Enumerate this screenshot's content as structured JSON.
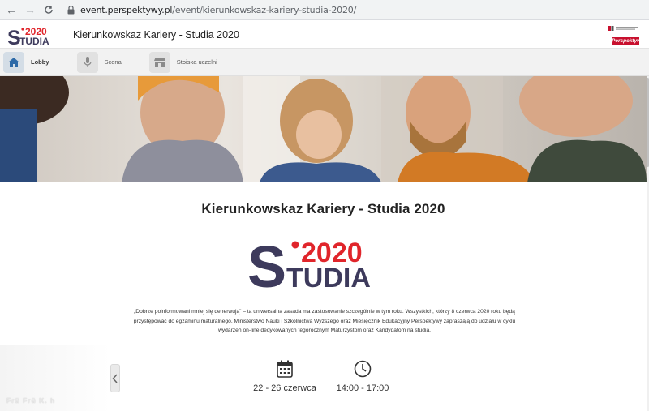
{
  "browser": {
    "url_host": "event.perspektywy.pl",
    "url_path": "/event/kierunkowskaz-kariery-studia-2020/"
  },
  "header": {
    "logo_year": "2020",
    "logo_text": "TUDIA",
    "logo_letter": "S",
    "title": "Kierunkowskaz Kariery - Studia 2020",
    "partner_logo_text": "Perspektywy"
  },
  "tabs": [
    {
      "label": "Lobby",
      "icon": "home-icon",
      "active": true
    },
    {
      "label": "Scena",
      "icon": "microphone-icon",
      "active": false
    },
    {
      "label": "Stoiska uczelni",
      "icon": "store-icon",
      "active": false
    }
  ],
  "main": {
    "title": "Kierunkowskaz Kariery - Studia 2020",
    "intro": "„Dobrze poinformowani mniej się denerwują” – ta uniwersalna zasada ma zastosowanie szczególnie w tym roku. Wszystkich, którzy 8 czerwca 2020 roku będą przystępować do egzaminu maturalnego, Ministerstwo Nauki i Szkolnictwa Wyższego oraz Miesięcznik Edukacyjny Perspektywy zapraszają do udziału w cyklu wydarzeń on-line dedykowanych tegorocznym Maturzystom oraz Kandydatom na studia.",
    "date": "22 - 26 czerwca",
    "time": "14:00 - 17:00"
  },
  "overlay": {
    "text": "Frü Frü K. h"
  },
  "colors": {
    "brand_navy": "#3d3a5c",
    "brand_red": "#e0252b",
    "tab_active": "#2d6aa8"
  }
}
